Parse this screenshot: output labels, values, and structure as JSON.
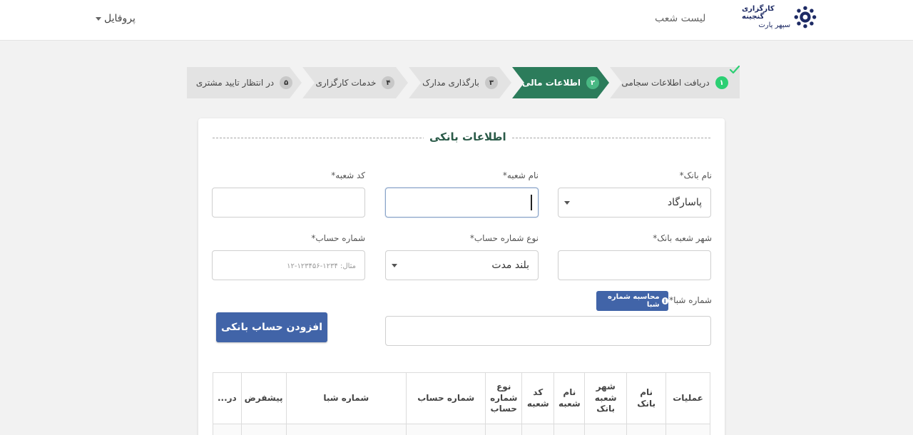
{
  "header": {
    "logo": {
      "line1": "کارگزاری گنجینه",
      "line2": "سپهر پارت"
    },
    "nav_branches": "لیست شعب",
    "nav_profile": "پروفایل"
  },
  "steps": [
    {
      "num": "۱",
      "label": "دریافت اطلاعات سجامی",
      "state": "done"
    },
    {
      "num": "۲",
      "label": "اطلاعات مالی",
      "state": "active"
    },
    {
      "num": "۳",
      "label": "بارگذاری مدارک",
      "state": "pending"
    },
    {
      "num": "۴",
      "label": "خدمات کارگزاری",
      "state": "pending"
    },
    {
      "num": "۵",
      "label": "در انتظار تایید مشتری",
      "state": "pending"
    }
  ],
  "form": {
    "legend": "اطلاعات بانکی",
    "bank_name": {
      "label": "نام بانک*",
      "value": "پاسارگاد"
    },
    "branch_name": {
      "label": "نام شعبه*",
      "value": ""
    },
    "branch_code": {
      "label": "کد شعبه*",
      "value": ""
    },
    "bank_city": {
      "label": "شهر شعبه بانک*",
      "value": ""
    },
    "account_type": {
      "label": "نوع شماره حساب*",
      "value": "بلند مدت"
    },
    "account_number": {
      "label": "شماره حساب*",
      "placeholder": "مثال: ۱۲۳۴-۱۲۳۴۵۶-۱۲"
    },
    "sheba": {
      "label": "شماره شبا*",
      "calc_button": "محاسبه شماره شبا",
      "value": ""
    },
    "add_button": "افزودن حساب بانکی"
  },
  "table": {
    "headers": [
      "عملیات",
      "نام بانک",
      "شهر شعبه بانک",
      "نام شعبه",
      "کد شعبه",
      "نوع شماره حساب",
      "شماره حساب",
      "شماره شبا",
      "پیشفرض",
      "در..."
    ]
  },
  "colors": {
    "active_step": "#2c7c5b",
    "primary_button": "#4164a8",
    "done_badge": "#2ccf73"
  }
}
